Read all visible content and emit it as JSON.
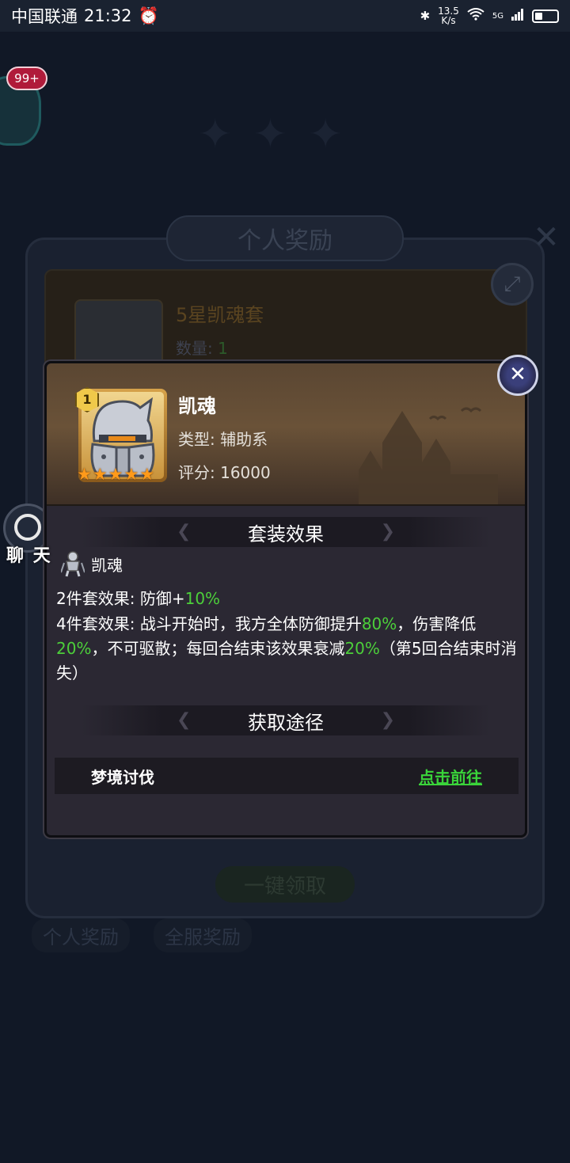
{
  "status_bar": {
    "carrier": "中国联通",
    "time": "21:32",
    "net_speed_value": "13.5",
    "net_speed_unit": "K/s",
    "network": "5G"
  },
  "background": {
    "badge_count": "99+",
    "panel_title": "个人奖励",
    "item_name": "5星凯魂套",
    "item_qty_label": "数量:",
    "item_qty_value": "1",
    "claim_all_label": "一键领取",
    "tabs": [
      "个人奖励",
      "全服奖励"
    ],
    "chat_label": "聊 天"
  },
  "popup": {
    "item": {
      "level": "1",
      "name": "凯魂",
      "type_label": "类型:",
      "type_value": "辅助系",
      "score_label": "评分:",
      "score_value": "16000",
      "stars": 5
    },
    "set_effect": {
      "title": "套装效果",
      "set_name": "凯魂",
      "two_piece_label": "2件套效果:",
      "two_piece_text": "防御+",
      "two_piece_value": "10%",
      "four_piece_label": "4件套效果:",
      "four_piece_parts": [
        "战斗开始时，我方全体防御提升",
        "80%",
        "，伤害降低",
        "20%",
        "，不可驱散；每回合结束该效果衰减",
        "20%",
        "（第5回合结束时消失）"
      ]
    },
    "source": {
      "title": "获取途径",
      "items": [
        {
          "name": "梦境讨伐",
          "action": "点击前往"
        }
      ]
    }
  },
  "colors": {
    "accent_green": "#4ccf3a",
    "link_green": "#3ad43a",
    "star_orange": "#ff9a1a"
  }
}
